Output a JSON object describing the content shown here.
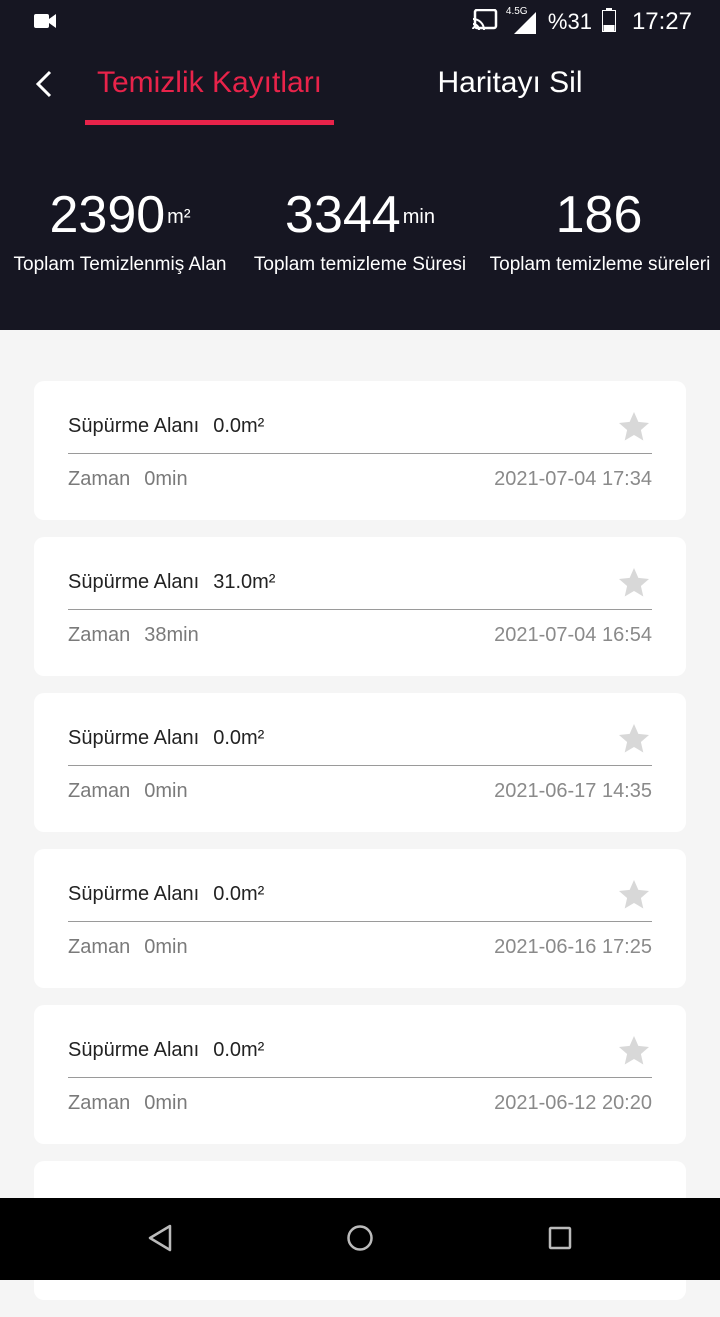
{
  "status_bar": {
    "network": "4.5G",
    "battery": "%31",
    "time": "17:27"
  },
  "tabs": {
    "active": "Temizlik Kayıtları",
    "other": "Haritayı Sil"
  },
  "stats": [
    {
      "value": "2390",
      "unit": "m²",
      "label": "Toplam Temizlenmiş Alan"
    },
    {
      "value": "3344",
      "unit": "min",
      "label": "Toplam temizleme Süresi"
    },
    {
      "value": "186",
      "unit": "",
      "label": "Toplam temizleme süreleri"
    }
  ],
  "records": [
    {
      "area_label": "Süpürme Alanı",
      "area": "0.0m²",
      "time_label": "Zaman",
      "time": "0min",
      "date": "2021-07-04 17:34"
    },
    {
      "area_label": "Süpürme Alanı",
      "area": "31.0m²",
      "time_label": "Zaman",
      "time": "38min",
      "date": "2021-07-04 16:54"
    },
    {
      "area_label": "Süpürme Alanı",
      "area": "0.0m²",
      "time_label": "Zaman",
      "time": "0min",
      "date": "2021-06-17 14:35"
    },
    {
      "area_label": "Süpürme Alanı",
      "area": "0.0m²",
      "time_label": "Zaman",
      "time": "0min",
      "date": "2021-06-16 17:25"
    },
    {
      "area_label": "Süpürme Alanı",
      "area": "0.0m²",
      "time_label": "Zaman",
      "time": "0min",
      "date": "2021-06-12 20:20"
    }
  ],
  "colors": {
    "header_bg": "#161622",
    "accent": "#e8234a",
    "star": "#d8d8d8"
  }
}
